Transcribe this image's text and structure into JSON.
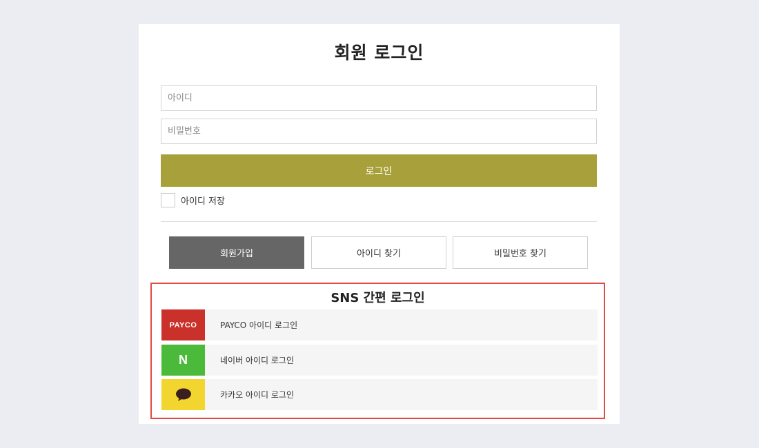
{
  "page": {
    "title": "회원 로그인"
  },
  "form": {
    "id_placeholder": "아이디",
    "id_value": "",
    "pw_placeholder": "비밀번호",
    "pw_value": "",
    "login_label": "로그인",
    "save_id_label": "아이디 저장",
    "save_id_checked": false
  },
  "actions": {
    "join_label": "회원가입",
    "find_id_label": "아이디 찾기",
    "find_pw_label": "비밀번호 찾기"
  },
  "sns": {
    "title": "SNS 간편 로그인",
    "items": [
      {
        "id": "payco",
        "logo_text": "PAYCO",
        "label": "PAYCO 아이디 로그인",
        "color": "#c9312a"
      },
      {
        "id": "naver",
        "logo_text": "N",
        "label": "네이버 아이디 로그인",
        "color": "#4bb93a"
      },
      {
        "id": "kakao",
        "logo_text": "",
        "label": "카카오 아이디 로그인",
        "color": "#f3d52f"
      }
    ]
  },
  "colors": {
    "background": "#ebedf2",
    "login_button": "#a8a03a",
    "join_button": "#666666",
    "sns_highlight_border": "#e24a45"
  },
  "icons": {
    "kakao_logo": "speech-bubble-icon",
    "naver_logo": "naver-n-icon",
    "payco_logo": "payco-wordmark-icon"
  }
}
